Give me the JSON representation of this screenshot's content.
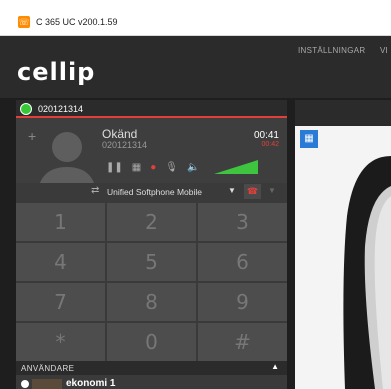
{
  "window": {
    "title": "C 365 UC v200.1.59"
  },
  "app": {
    "logo": "cellip"
  },
  "nav": {
    "settings": "INSTÄLLNINGAR",
    "more": "VI"
  },
  "line": {
    "number": "020121314"
  },
  "call": {
    "name": "Okänd",
    "number": "020121314",
    "time": "00:41",
    "time_sub": "00:42",
    "add_symbol": "+"
  },
  "device": {
    "name": "Unified Softphone Mobile"
  },
  "dialpad": {
    "keys": [
      "1",
      "2",
      "3",
      "4",
      "5",
      "6",
      "7",
      "8",
      "9",
      "*",
      "0",
      "#"
    ]
  },
  "users": {
    "header": "ANVÄNDARE",
    "first_user": "ekonomi 1"
  },
  "colors": {
    "accent": "#e0403c",
    "status": "#37c837",
    "calendar": "#2a7bd6"
  }
}
